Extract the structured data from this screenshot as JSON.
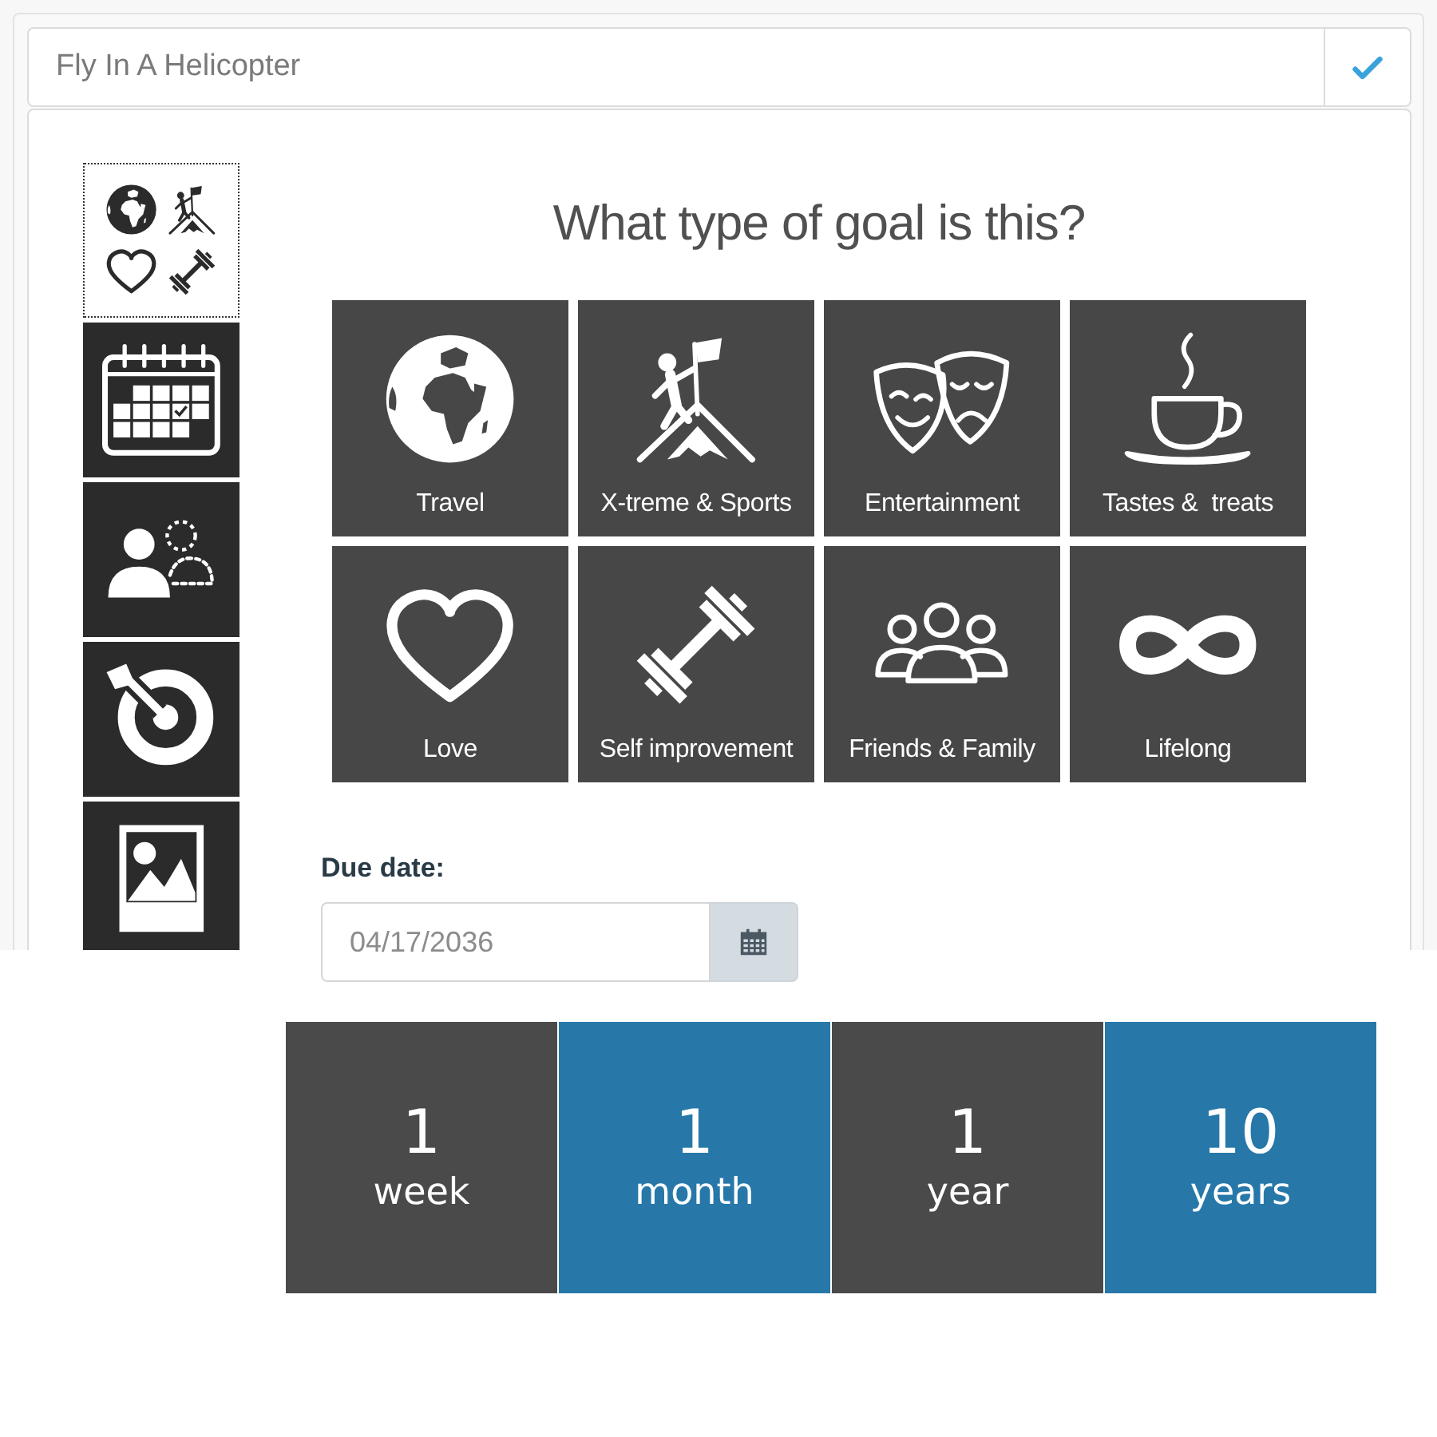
{
  "goal_title": {
    "value": "Fly In A Helicopter"
  },
  "steps": [
    {
      "selected": true
    },
    {
      "selected": false
    },
    {
      "selected": false
    },
    {
      "selected": false
    },
    {
      "selected": false
    }
  ],
  "question": "What type of goal is this?",
  "goal_types": [
    {
      "label": "Travel"
    },
    {
      "label": "X-treme & Sports"
    },
    {
      "label": "Entertainment"
    },
    {
      "label": "Tastes &  treats"
    },
    {
      "label": "Love"
    },
    {
      "label": "Self improvement"
    },
    {
      "label": "Friends & Family"
    },
    {
      "label": "Lifelong"
    }
  ],
  "due_date": {
    "label": "Due date:",
    "value": "04/17/2036"
  },
  "durations": [
    {
      "amount": "1",
      "unit": "week",
      "color": "#4a4a4a"
    },
    {
      "amount": "1",
      "unit": "month",
      "color": "#2778a9"
    },
    {
      "amount": "1",
      "unit": "year",
      "color": "#4a4a4a"
    },
    {
      "amount": "10",
      "unit": "years",
      "color": "#2778a9"
    }
  ]
}
